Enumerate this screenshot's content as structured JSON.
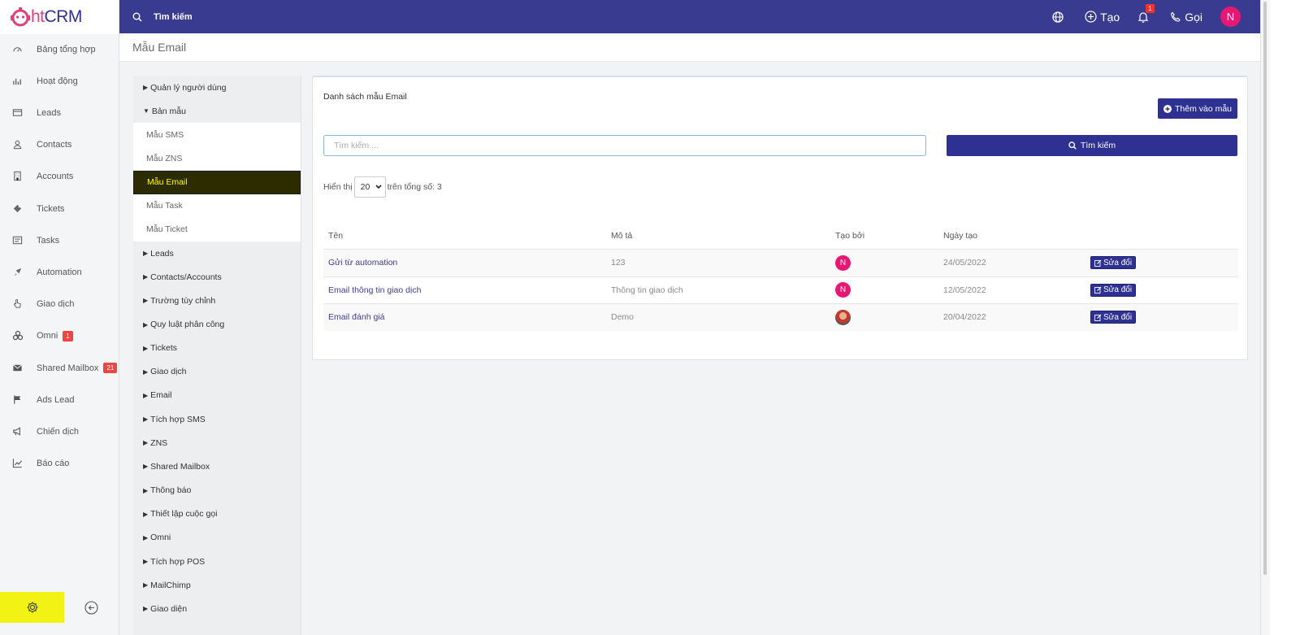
{
  "brand": {
    "logo_left": "ht",
    "logo_right": "CRM"
  },
  "sidebar": {
    "items": [
      {
        "label": "Bảng tổng hợp",
        "icon": "dashboard-icon"
      },
      {
        "label": "Hoạt động",
        "icon": "activity-chart-icon"
      },
      {
        "label": "Leads",
        "icon": "leads-card-icon"
      },
      {
        "label": "Contacts",
        "icon": "contacts-user-icon"
      },
      {
        "label": "Accounts",
        "icon": "building-icon"
      },
      {
        "label": "Tickets",
        "icon": "ticket-icon"
      },
      {
        "label": "Tasks",
        "icon": "tasks-list-icon"
      },
      {
        "label": "Automation",
        "icon": "rocket-icon"
      },
      {
        "label": "Giao dịch",
        "icon": "hand-pointer-icon"
      },
      {
        "label": "Omni",
        "icon": "omni-icon",
        "badge": "1"
      },
      {
        "label": "Shared Mailbox",
        "icon": "envelope-icon",
        "badge": "21"
      },
      {
        "label": "Ads Lead",
        "icon": "flag-icon"
      },
      {
        "label": "Chiến dịch",
        "icon": "megaphone-icon"
      },
      {
        "label": "Báo cáo",
        "icon": "line-chart-icon"
      }
    ]
  },
  "topbar": {
    "search_label": "Tìm kiếm",
    "create_label": "Tạo",
    "notification_count": "1",
    "call_label": "Gọi",
    "avatar_initial": "N"
  },
  "page": {
    "title": "Mẫu Email"
  },
  "settings_menu": {
    "items": [
      {
        "label": "Quản lý người dùng",
        "type": "collapsed"
      },
      {
        "label": "Bản mẫu",
        "type": "expanded"
      },
      {
        "label": "Mẫu SMS",
        "type": "sub"
      },
      {
        "label": "Mẫu ZNS",
        "type": "sub"
      },
      {
        "label": "Mẫu Email",
        "type": "active"
      },
      {
        "label": "Mẫu Task",
        "type": "sub"
      },
      {
        "label": "Mẫu Ticket",
        "type": "sub"
      },
      {
        "label": "Leads",
        "type": "collapsed"
      },
      {
        "label": "Contacts/Accounts",
        "type": "collapsed"
      },
      {
        "label": "Trường tùy chỉnh",
        "type": "collapsed"
      },
      {
        "label": "Quy luật phân công",
        "type": "collapsed"
      },
      {
        "label": "Tickets",
        "type": "collapsed"
      },
      {
        "label": "Giao dịch",
        "type": "collapsed"
      },
      {
        "label": "Email",
        "type": "collapsed"
      },
      {
        "label": "Tích hợp SMS",
        "type": "collapsed"
      },
      {
        "label": "ZNS",
        "type": "collapsed"
      },
      {
        "label": "Shared Mailbox",
        "type": "collapsed"
      },
      {
        "label": "Thông báo",
        "type": "collapsed"
      },
      {
        "label": "Thiết lập cuộc gọi",
        "type": "collapsed"
      },
      {
        "label": "Omni",
        "type": "collapsed"
      },
      {
        "label": "Tích hợp POS",
        "type": "collapsed"
      },
      {
        "label": "MailChimp",
        "type": "collapsed"
      },
      {
        "label": "Giao diện",
        "type": "collapsed"
      }
    ]
  },
  "card": {
    "title": "Danh sách mẫu Email",
    "add_label": "Thêm vào mẫu",
    "search_placeholder": "Tìm kiếm ...",
    "search_value": "",
    "search_button": "Tìm kiếm",
    "show_label": "Hiển thị",
    "per_page": "20",
    "total_label": "trên tổng số: 3"
  },
  "table": {
    "headers": [
      "Tên",
      "Mô tả",
      "Tạo bởi",
      "Ngày tạo"
    ],
    "rows": [
      {
        "name": "Gửi từ automation",
        "description": "123",
        "creator": "N",
        "creator_type": "initial",
        "date": "24/05/2022",
        "action": "Sửa đổi"
      },
      {
        "name": "Email thông tin giao dịch",
        "description": "Thông tin giao dịch",
        "creator": "N",
        "creator_type": "initial",
        "date": "12/05/2022",
        "action": "Sửa đổi"
      },
      {
        "name": "Email đánh giá",
        "description": "Demo",
        "creator": "",
        "creator_type": "photo",
        "date": "20/04/2022",
        "action": "Sửa đổi"
      }
    ]
  },
  "colors": {
    "primary": "#2e3192",
    "topbar": "#383b8f",
    "accent_pink": "#e61873",
    "active_item_bg": "#2d2b00",
    "active_item_text": "#ffff00",
    "settings_highlight": "#f2f214"
  }
}
